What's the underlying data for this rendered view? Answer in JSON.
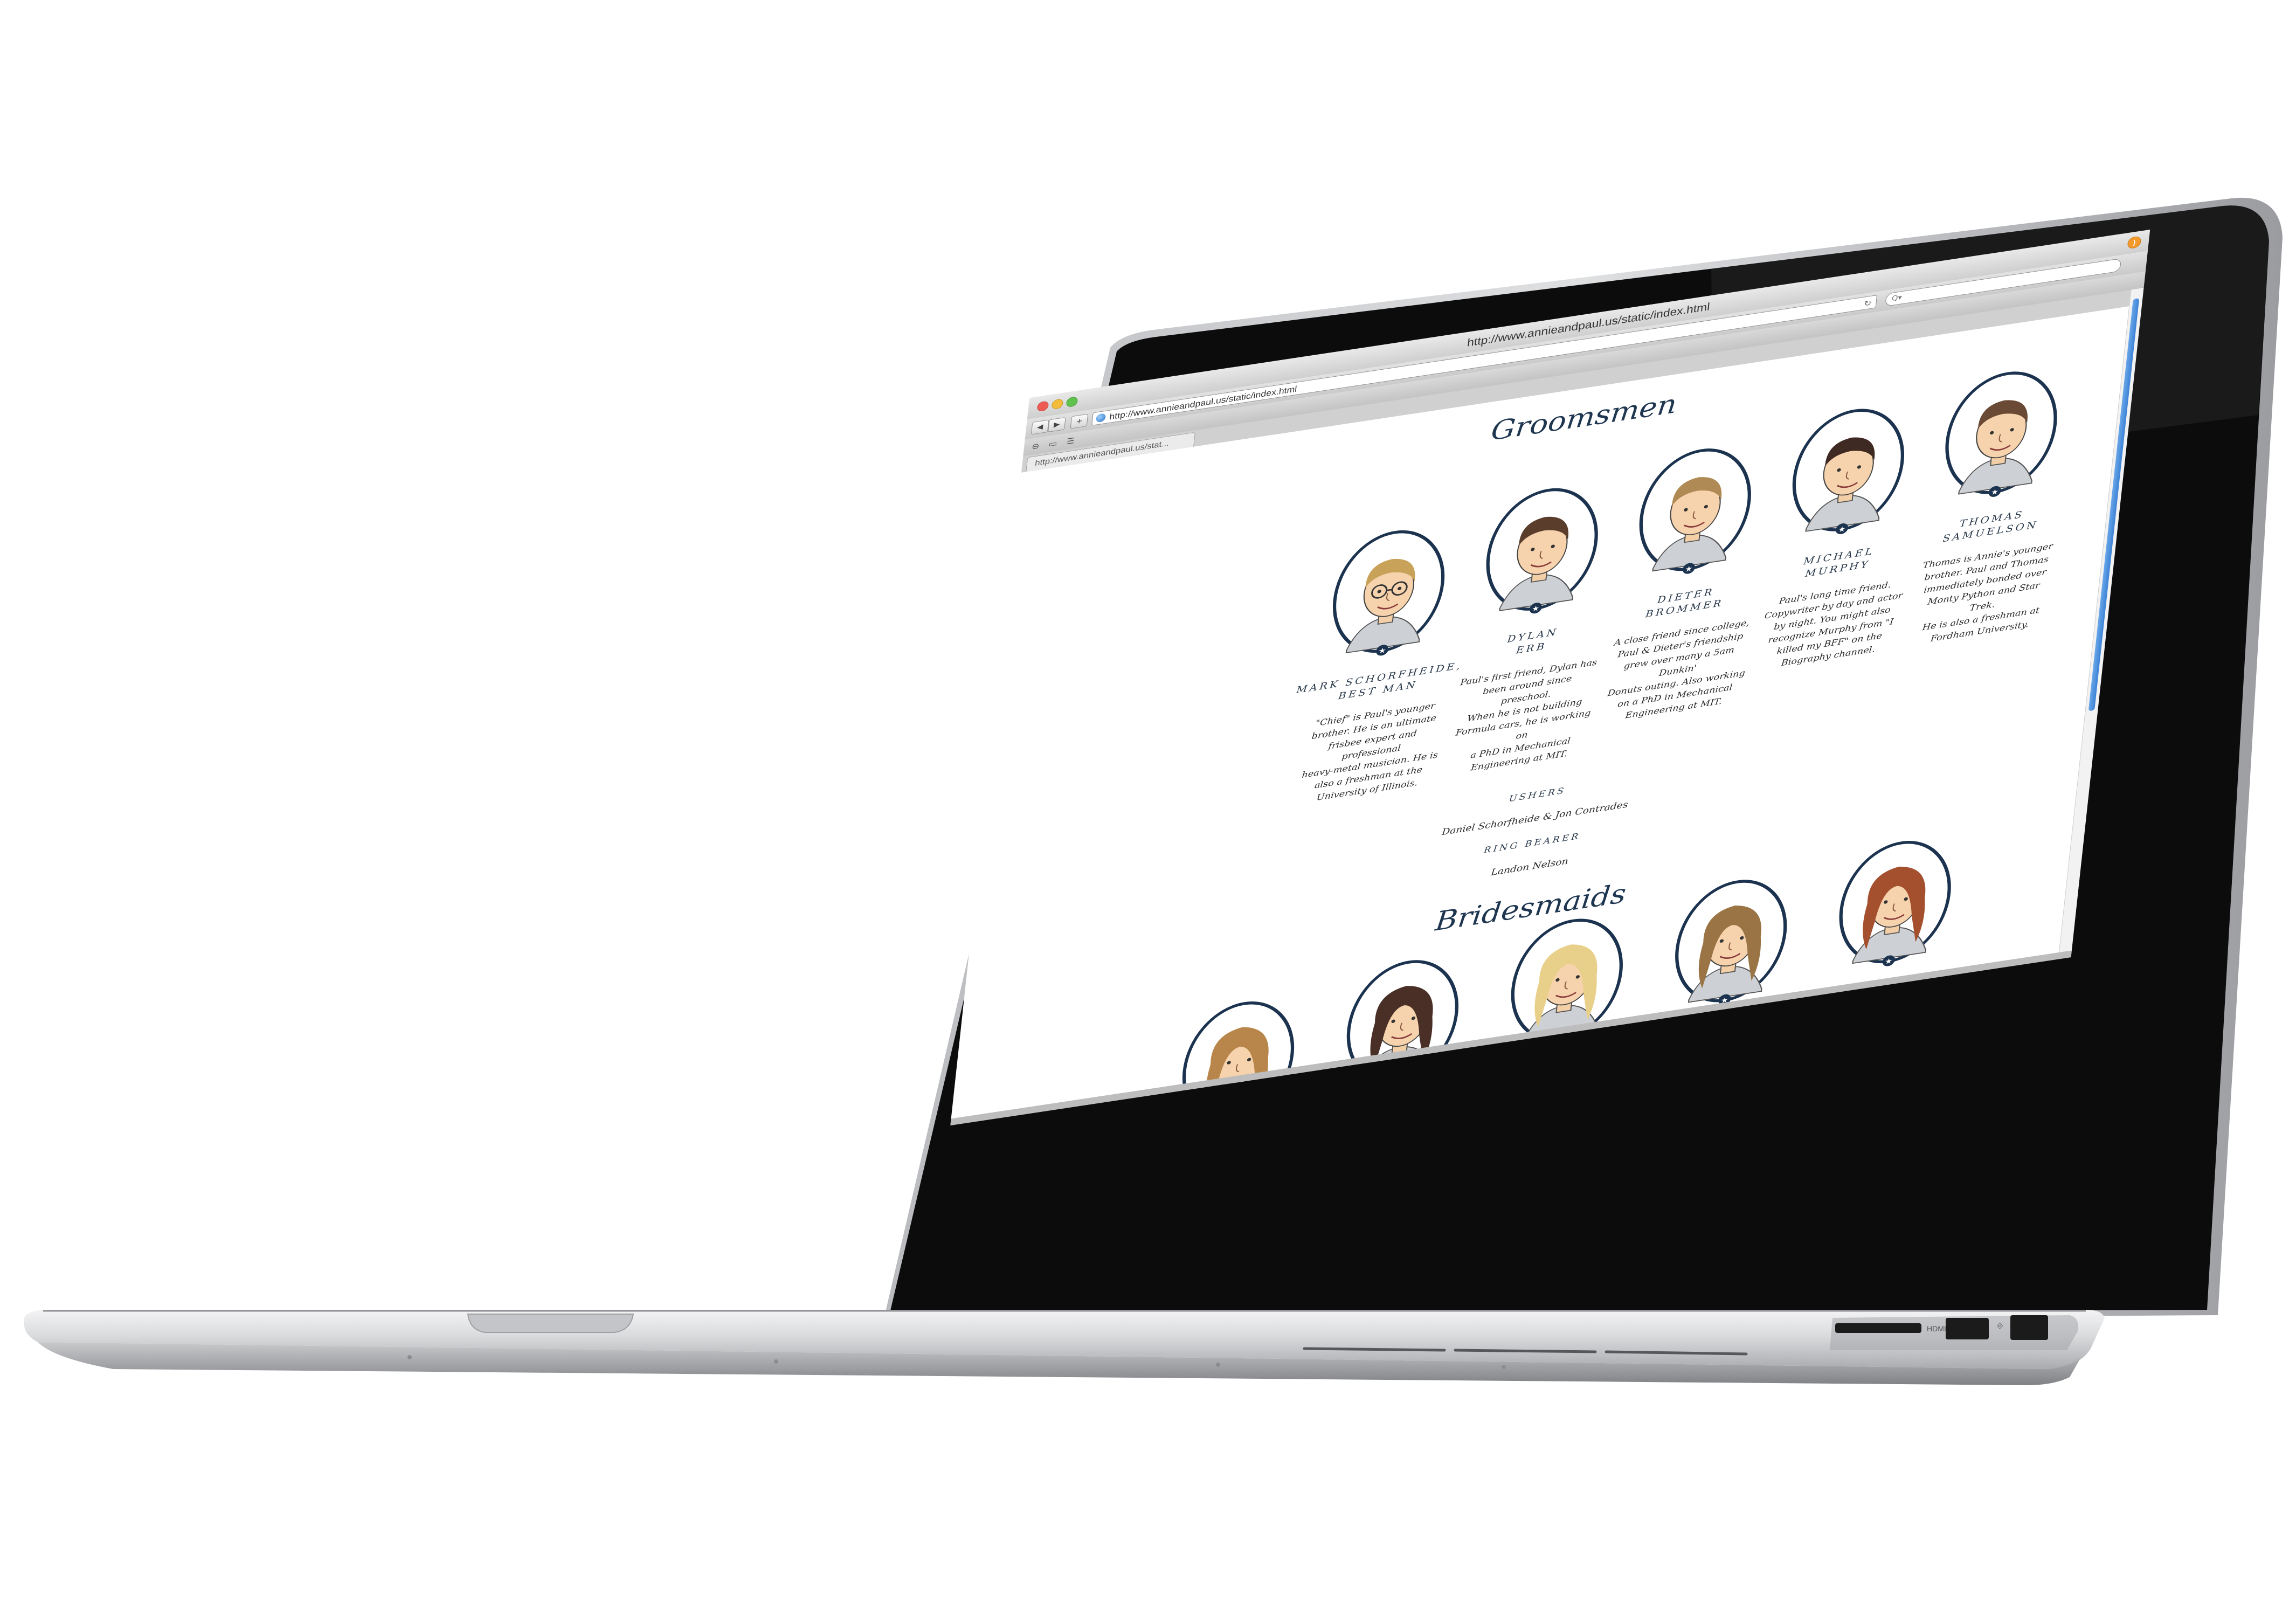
{
  "browser": {
    "window_title": "http://www.annieandpaul.us/static/index.html",
    "url": "http://www.annieandpaul.us/static/index.html",
    "search_placeholder": "Q▾",
    "tab_label": "http://www.annieandpaul.us/stat...",
    "rss_label": "RSS"
  },
  "groomsmen": {
    "heading": "Groomsmen",
    "members": [
      {
        "name": "MARK SCHORFHEIDE,",
        "name2": "BEST MAN",
        "bio": [
          "\"Chief\" is Paul's younger",
          "brother. He is an ultimate",
          "frisbee expert and professional",
          "heavy-metal musician. He is",
          "also a freshman at the",
          "University of Illinois."
        ],
        "hair": "#c9a25a",
        "glasses": true
      },
      {
        "name": "DYLAN",
        "name2": "ERB",
        "bio": [
          "Paul's first friend, Dylan has",
          "been around since preschool.",
          "When he is not building",
          "Formula cars, he is working on",
          "a PhD in Mechanical",
          "Engineering at MIT."
        ],
        "hair": "#5a3e2b",
        "glasses": false
      },
      {
        "name": "DIETER",
        "name2": "BROMMER",
        "bio": [
          "A close friend since college,",
          "Paul & Dieter's friendship",
          "grew over many a 5am Dunkin'",
          "Donuts outing. Also working",
          "on a PhD in Mechanical",
          "Engineering at MIT."
        ],
        "hair": "#b08a55",
        "glasses": false
      },
      {
        "name": "MICHAEL",
        "name2": "MURPHY",
        "bio": [
          "Paul's long time friend.",
          "Copywriter by day and actor",
          "by night. You might also",
          "recognize Murphy from \"I",
          "killed my BFF\" on the",
          "Biography channel."
        ],
        "hair": "#3e2a22",
        "glasses": false
      },
      {
        "name": "THOMAS",
        "name2": "SAMUELSON",
        "bio": [
          "Thomas is Annie's younger",
          "brother. Paul and Thomas",
          "immediately bonded over",
          "Monty Python and Star Trek.",
          "He is also a freshman at",
          "Fordham University."
        ],
        "hair": "#6a4a35",
        "glasses": false
      }
    ]
  },
  "ushers": {
    "label": "USHERS",
    "names": "Daniel Schorfheide & Jon Contrades"
  },
  "ring_bearer": {
    "label": "RING BEARER",
    "name": "Landon Nelson"
  },
  "bridesmaids": {
    "heading": "Bridesmaids",
    "hair_colors": [
      "#b8864a",
      "#4a2f26",
      "#e8d08a",
      "#9a7445",
      "#a4502e"
    ]
  },
  "laptop": {
    "ports": {
      "hdmi": "HDMI"
    }
  }
}
